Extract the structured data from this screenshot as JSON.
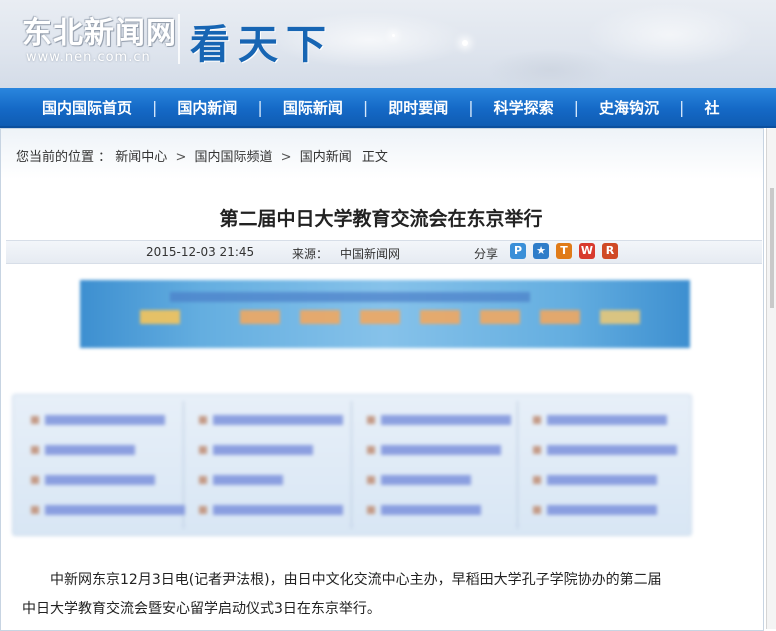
{
  "header": {
    "logo_text": "东北新闻网",
    "logo_url": "www.nen.com.cn",
    "section_title": "看天下"
  },
  "nav": {
    "items": [
      {
        "label": "国内国际首页"
      },
      {
        "label": "国内新闻"
      },
      {
        "label": "国际新闻"
      },
      {
        "label": "即时要闻"
      },
      {
        "label": "科学探索"
      },
      {
        "label": "史海钩沉"
      },
      {
        "label": "社"
      }
    ],
    "separator": "|"
  },
  "breadcrumb": {
    "prefix": "您当前的位置 ：",
    "items": [
      "新闻中心",
      "国内国际频道",
      "国内新闻"
    ],
    "separator": ">",
    "suffix": "正文"
  },
  "article": {
    "title": "第二届中日大学教育交流会在东京举行",
    "date": "2015-12-03 21:45",
    "source_label": "来源：",
    "source": "中国新闻网",
    "share_label": "分享",
    "paragraph_1": "中新网东京12月3日电(记者尹法根)，由日中文化交流中心主办，早稻田大学孔子学院协办的第二届",
    "paragraph_2": "中日大学教育交流会暨安心留学启动仪式3日在东京举行。"
  },
  "share_icons": [
    {
      "name": "qzone-icon",
      "glyph": "P",
      "color": "#3a8fd8"
    },
    {
      "name": "favorite-star-icon",
      "glyph": "★",
      "color": "#2f7dc9"
    },
    {
      "name": "tqq-icon",
      "glyph": "T",
      "color": "#e07b18"
    },
    {
      "name": "weibo-icon",
      "glyph": "W",
      "color": "#d83a2e"
    },
    {
      "name": "renren-icon",
      "glyph": "R",
      "color": "#d04a26"
    }
  ],
  "colors": {
    "nav_blue": "#1569c6",
    "title_blue": "#1765b3"
  }
}
